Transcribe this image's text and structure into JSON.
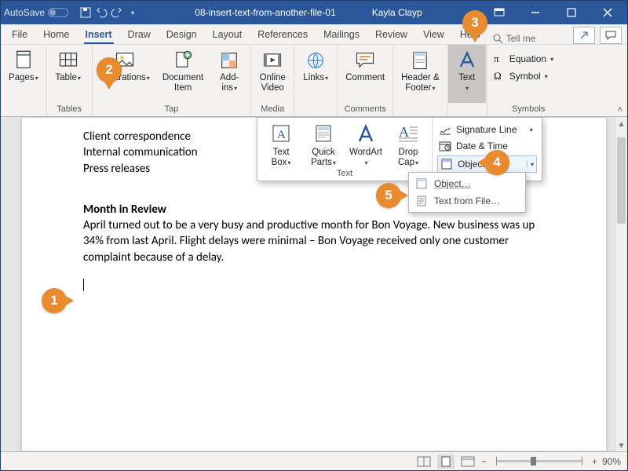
{
  "titlebar": {
    "autosave": "AutoSave",
    "document_title": "08-insert-text-from-another-file-01",
    "user_name": "Kayla Clayp"
  },
  "tabs": {
    "items": [
      "File",
      "Home",
      "Insert",
      "Draw",
      "Design",
      "Layout",
      "References",
      "Mailings",
      "Review",
      "View",
      "Help"
    ],
    "active_index": 2,
    "tell_me": "Tell me"
  },
  "ribbon": {
    "groups": {
      "tables": {
        "label": "Tables",
        "pages": "Pages",
        "table": "Table"
      },
      "tap": {
        "label": "Tap",
        "illustrations": "Illustrations",
        "doc_item": "Document\nItem",
        "addins": "Add-\nins"
      },
      "media": {
        "label": "Media",
        "online_video": "Online\nVideo"
      },
      "links": {
        "label": "",
        "links": "Links"
      },
      "comments": {
        "label": "Comments",
        "comment": "Comment"
      },
      "hf": {
        "label": "",
        "header_footer": "Header &\nFooter"
      },
      "text": {
        "label": "",
        "text": "Text"
      },
      "symbols": {
        "label": "Symbols",
        "equation": "Equation",
        "symbol": "Symbol"
      }
    }
  },
  "text_panel": {
    "group_label": "Text",
    "text_box": "Text\nBox",
    "quick_parts": "Quick\nParts",
    "wordart": "WordArt",
    "drop_cap": "Drop\nCap",
    "signature_line": "Signature Line",
    "date_time": "Date & Time",
    "object": "Object",
    "object_menu": {
      "object_item": "Object…",
      "text_from_file": "Text from File…"
    }
  },
  "document": {
    "line1": "Client correspondence",
    "line2": "Internal communication",
    "line3": "Press releases",
    "heading": "Month in Review",
    "body": "April turned out to be a very busy and productive month for Bon Voyage. New business was up 34% from last April. Flight delays were minimal – Bon Voyage received only one customer complaint because of a delay."
  },
  "statusbar": {
    "zoom": "90%"
  },
  "callouts": {
    "c1": "1",
    "c2": "2",
    "c3": "3",
    "c4": "4",
    "c5": "5"
  }
}
